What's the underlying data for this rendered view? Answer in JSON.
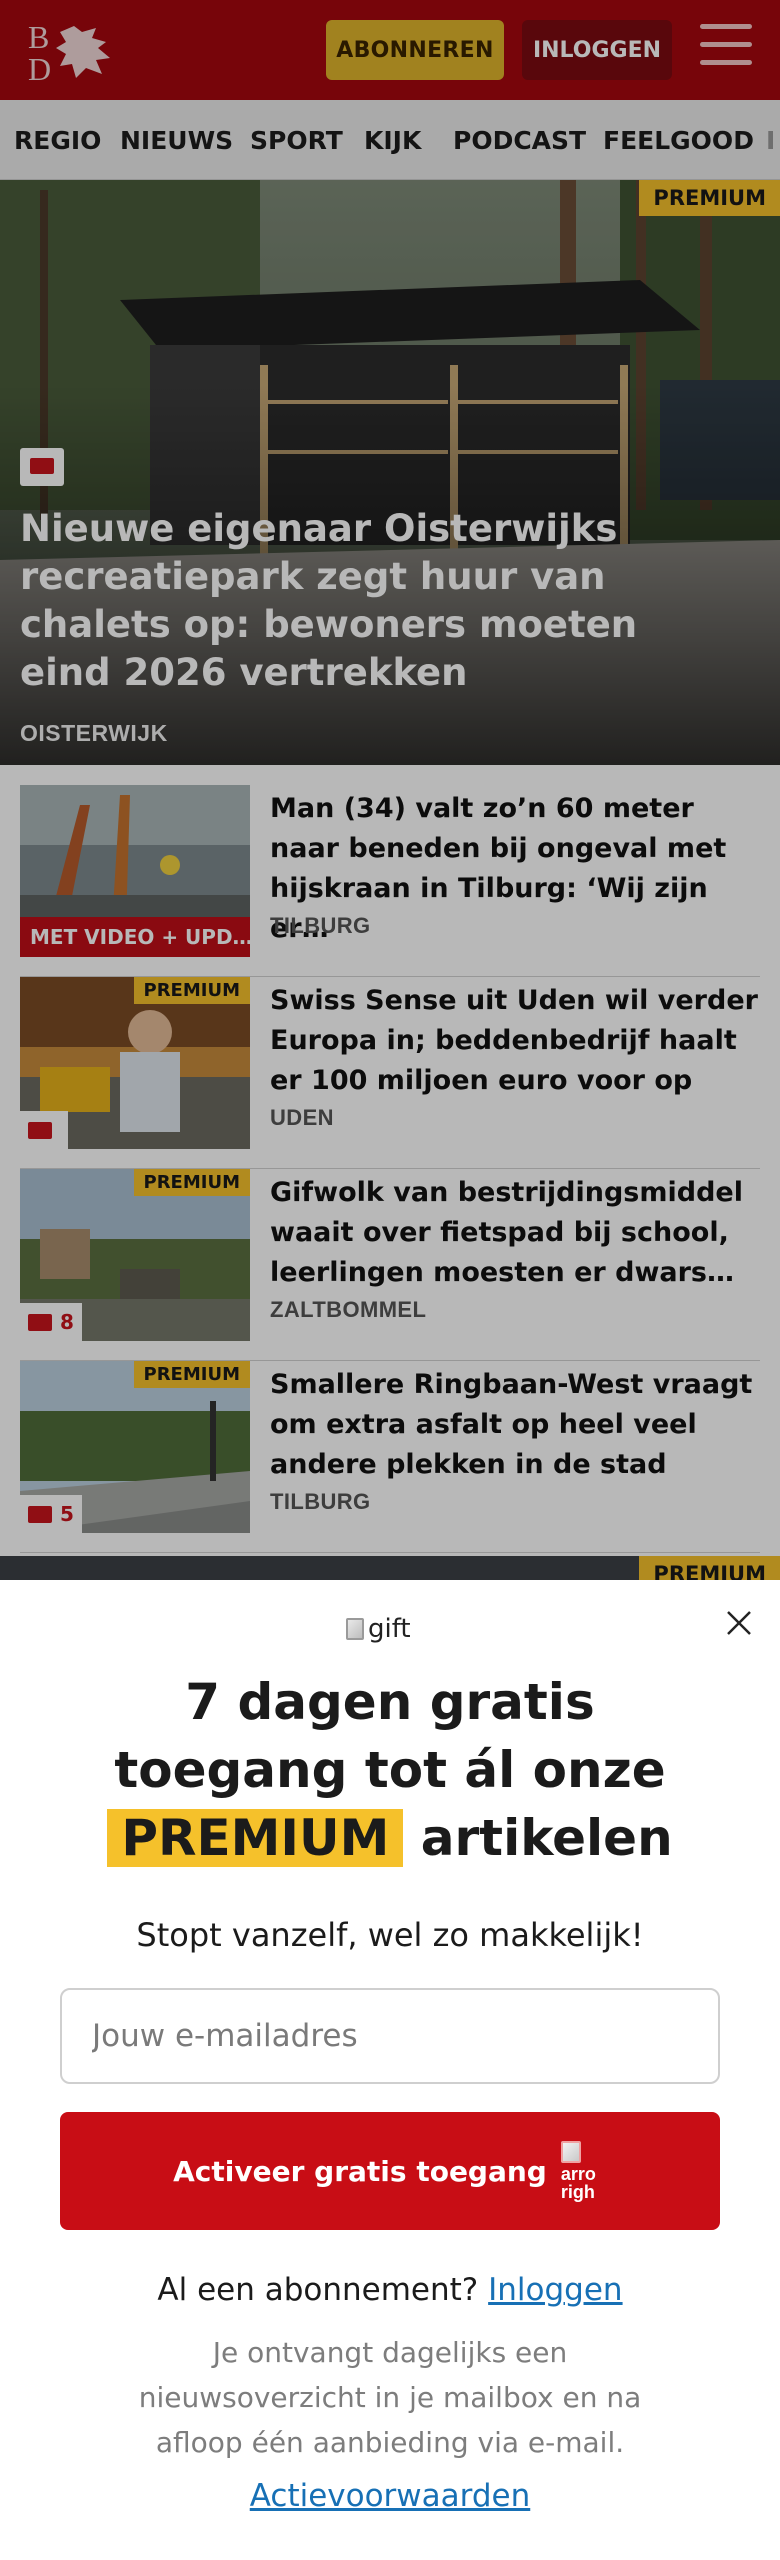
{
  "header": {
    "logo_text": "BD",
    "subscribe_label": "ABONNEREN",
    "login_label": "INLOGGEN",
    "brand_color": "#a5080f"
  },
  "nav": {
    "items": [
      "REGIO",
      "NIEUWS",
      "SPORT",
      "KIJK",
      "PODCAST",
      "FEELGOOD",
      "I"
    ]
  },
  "hero": {
    "badge": "PREMIUM",
    "title": "Nieuwe eigenaar Oisterwijks recreatiepark zegt huur van chalets op: bewoners moeten eind 2026 vertrekken",
    "location": "OISTERWIJK",
    "icon": "comment-icon"
  },
  "articles": [
    {
      "title": "Man (34) valt zo’n 60 meter naar beneden bij ongeval met hijskraan in Tilburg: ‘Wij zijn er…",
      "location": "TILBURG",
      "badge": "MET VIDEO + UPD…"
    },
    {
      "title": "Swiss Sense uit Uden wil verder Europa in; beddenbedrijf haalt er 100 miljoen euro voor op",
      "location": "UDEN",
      "badge": "PREMIUM",
      "comments": ""
    },
    {
      "title": "Gifwolk van bestrijdingsmiddel waait over fietspad bij school, leerlingen moesten er dwars…",
      "location": "ZALTBOMMEL",
      "badge": "PREMIUM",
      "comments": "8"
    },
    {
      "title": "Smallere Ringbaan-West vraagt om extra asfalt op heel veel andere plekken in de stad",
      "location": "TILBURG",
      "badge": "PREMIUM",
      "comments": "5"
    }
  ],
  "next_hero": {
    "badge": "PREMIUM"
  },
  "modal": {
    "image_alt": "gift",
    "title_line1": "7 dagen gratis",
    "title_line2": "toegang tot ál onze",
    "title_highlight": "PREMIUM",
    "title_line3_rest": "artikelen",
    "subtitle": "Stopt vanzelf, wel zo makkelijk!",
    "email_placeholder": "Jouw e-mailadres",
    "cta_label": "Activeer gratis toegang",
    "cta_icon_alt": "arrow-right",
    "cta_icon_text_1": "arro",
    "cta_icon_text_2": "righ",
    "have_sub_text": "Al een abonnement?",
    "have_sub_link": "Inloggen",
    "info": "Je ontvangt dagelijks een nieuwsoverzicht in je mailbox en na afloop één aanbieding via e-mail.",
    "terms": "Actievoorwaarden",
    "accent_color": "#c80d15",
    "highlight_color": "#f5c12b"
  }
}
